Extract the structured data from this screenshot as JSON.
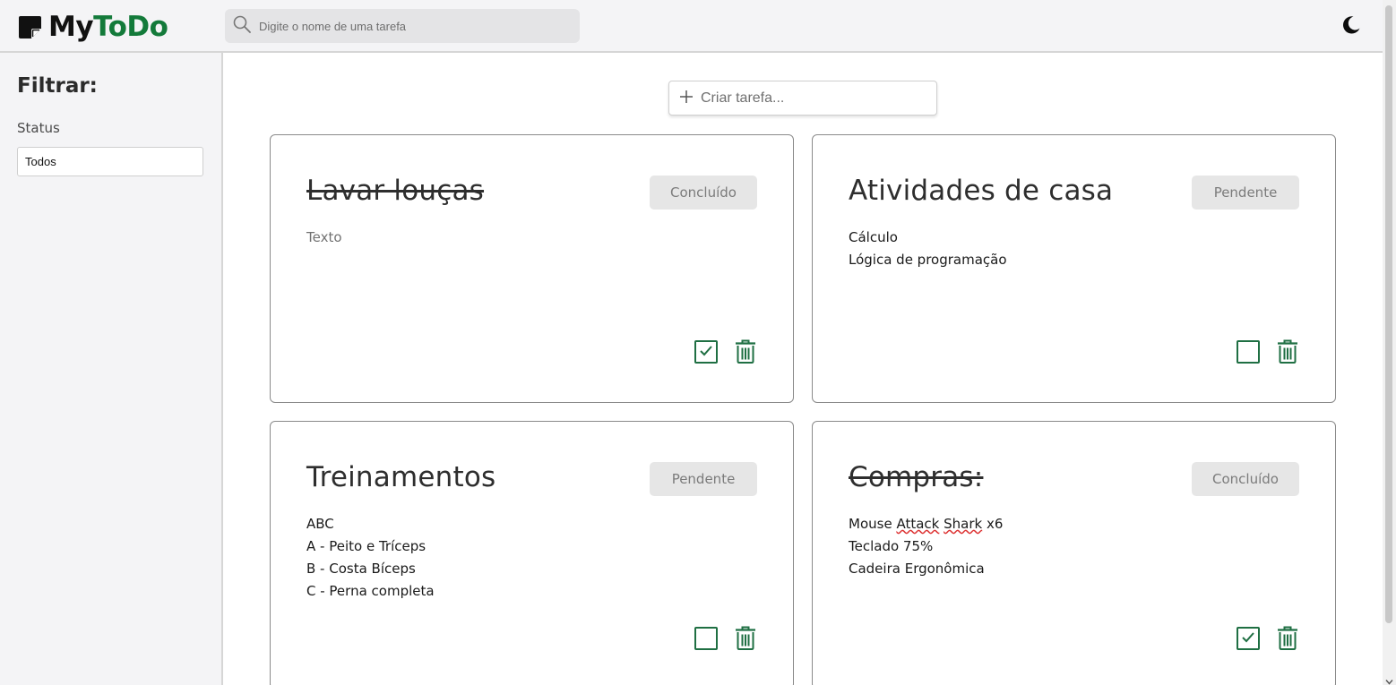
{
  "header": {
    "logo_part1": "My",
    "logo_part2": "ToDo",
    "logo_icon": "sticky-note-icon",
    "search_placeholder": "Digite o nome de uma tarefa",
    "search_icon": "search-icon",
    "theme_icon": "moon-icon"
  },
  "sidebar": {
    "title": "Filtrar:",
    "status_label": "Status",
    "status_selected": "Todos"
  },
  "main": {
    "create_placeholder": "Criar tarefa...",
    "create_icon": "plus-icon"
  },
  "tasks": [
    {
      "title": "Lavar louças",
      "status": "Concluído",
      "done": true,
      "lines": [
        "Texto"
      ]
    },
    {
      "title": "Atividades de casa",
      "status": "Pendente",
      "done": false,
      "lines": [
        "Cálculo",
        "Lógica de programação"
      ]
    },
    {
      "title": "Treinamentos",
      "status": "Pendente",
      "done": false,
      "lines": [
        "ABC",
        "A - Peito e Tríceps",
        "B - Costa Bíceps",
        "C - Perna completa"
      ]
    },
    {
      "title": "Compras:",
      "status": "Concluído",
      "done": true,
      "lines": [
        "Mouse Attack Shark x6",
        "Teclado 75%",
        "Cadeira Ergonômica"
      ]
    }
  ],
  "colors": {
    "brand_green": "#137a3a",
    "icon_green": "#1f6f43",
    "badge_bg": "#e6e6e6"
  }
}
